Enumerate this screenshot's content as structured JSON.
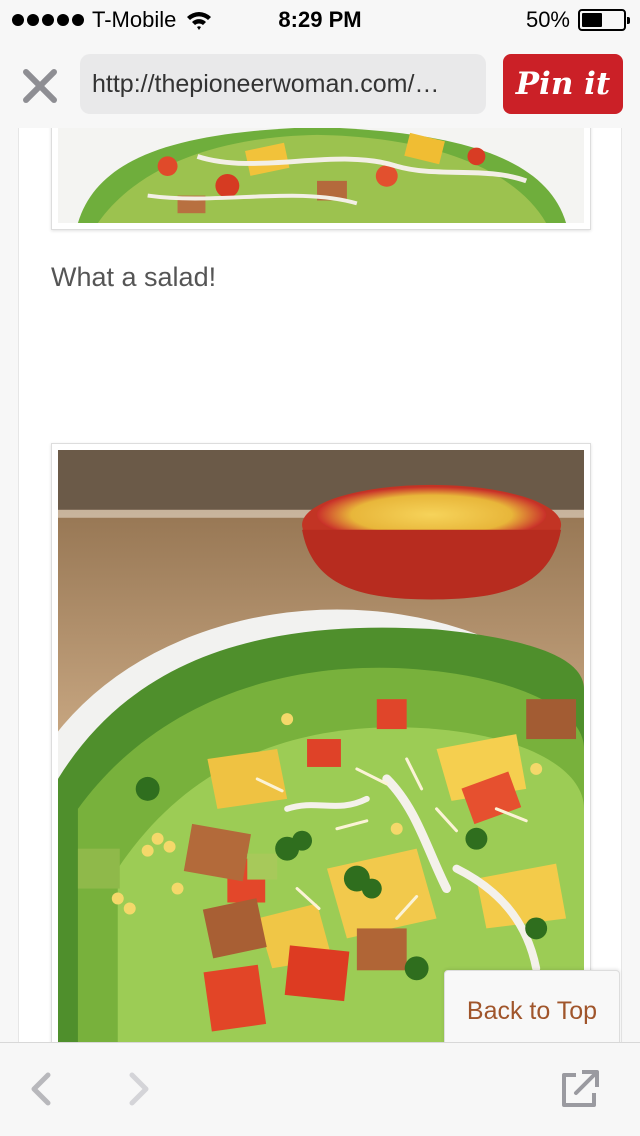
{
  "status_bar": {
    "carrier": "T-Mobile",
    "time": "8:29 PM",
    "battery": "50%",
    "battery_level": 0.5
  },
  "nav": {
    "url": "http://thepioneerwoman.com/…",
    "pin_label": "Pin it"
  },
  "content": {
    "caption": "What a salad!",
    "back_to_top": "Back to Top"
  },
  "icons": {
    "close": "close-icon",
    "back": "chevron-left-icon",
    "forward": "chevron-right-icon",
    "share": "open-external-icon",
    "wifi": "wifi-icon",
    "battery": "battery-icon"
  },
  "colors": {
    "pin_button": "#cb2027",
    "back_to_top_text": "#a0552b",
    "caption_text": "#555555"
  }
}
